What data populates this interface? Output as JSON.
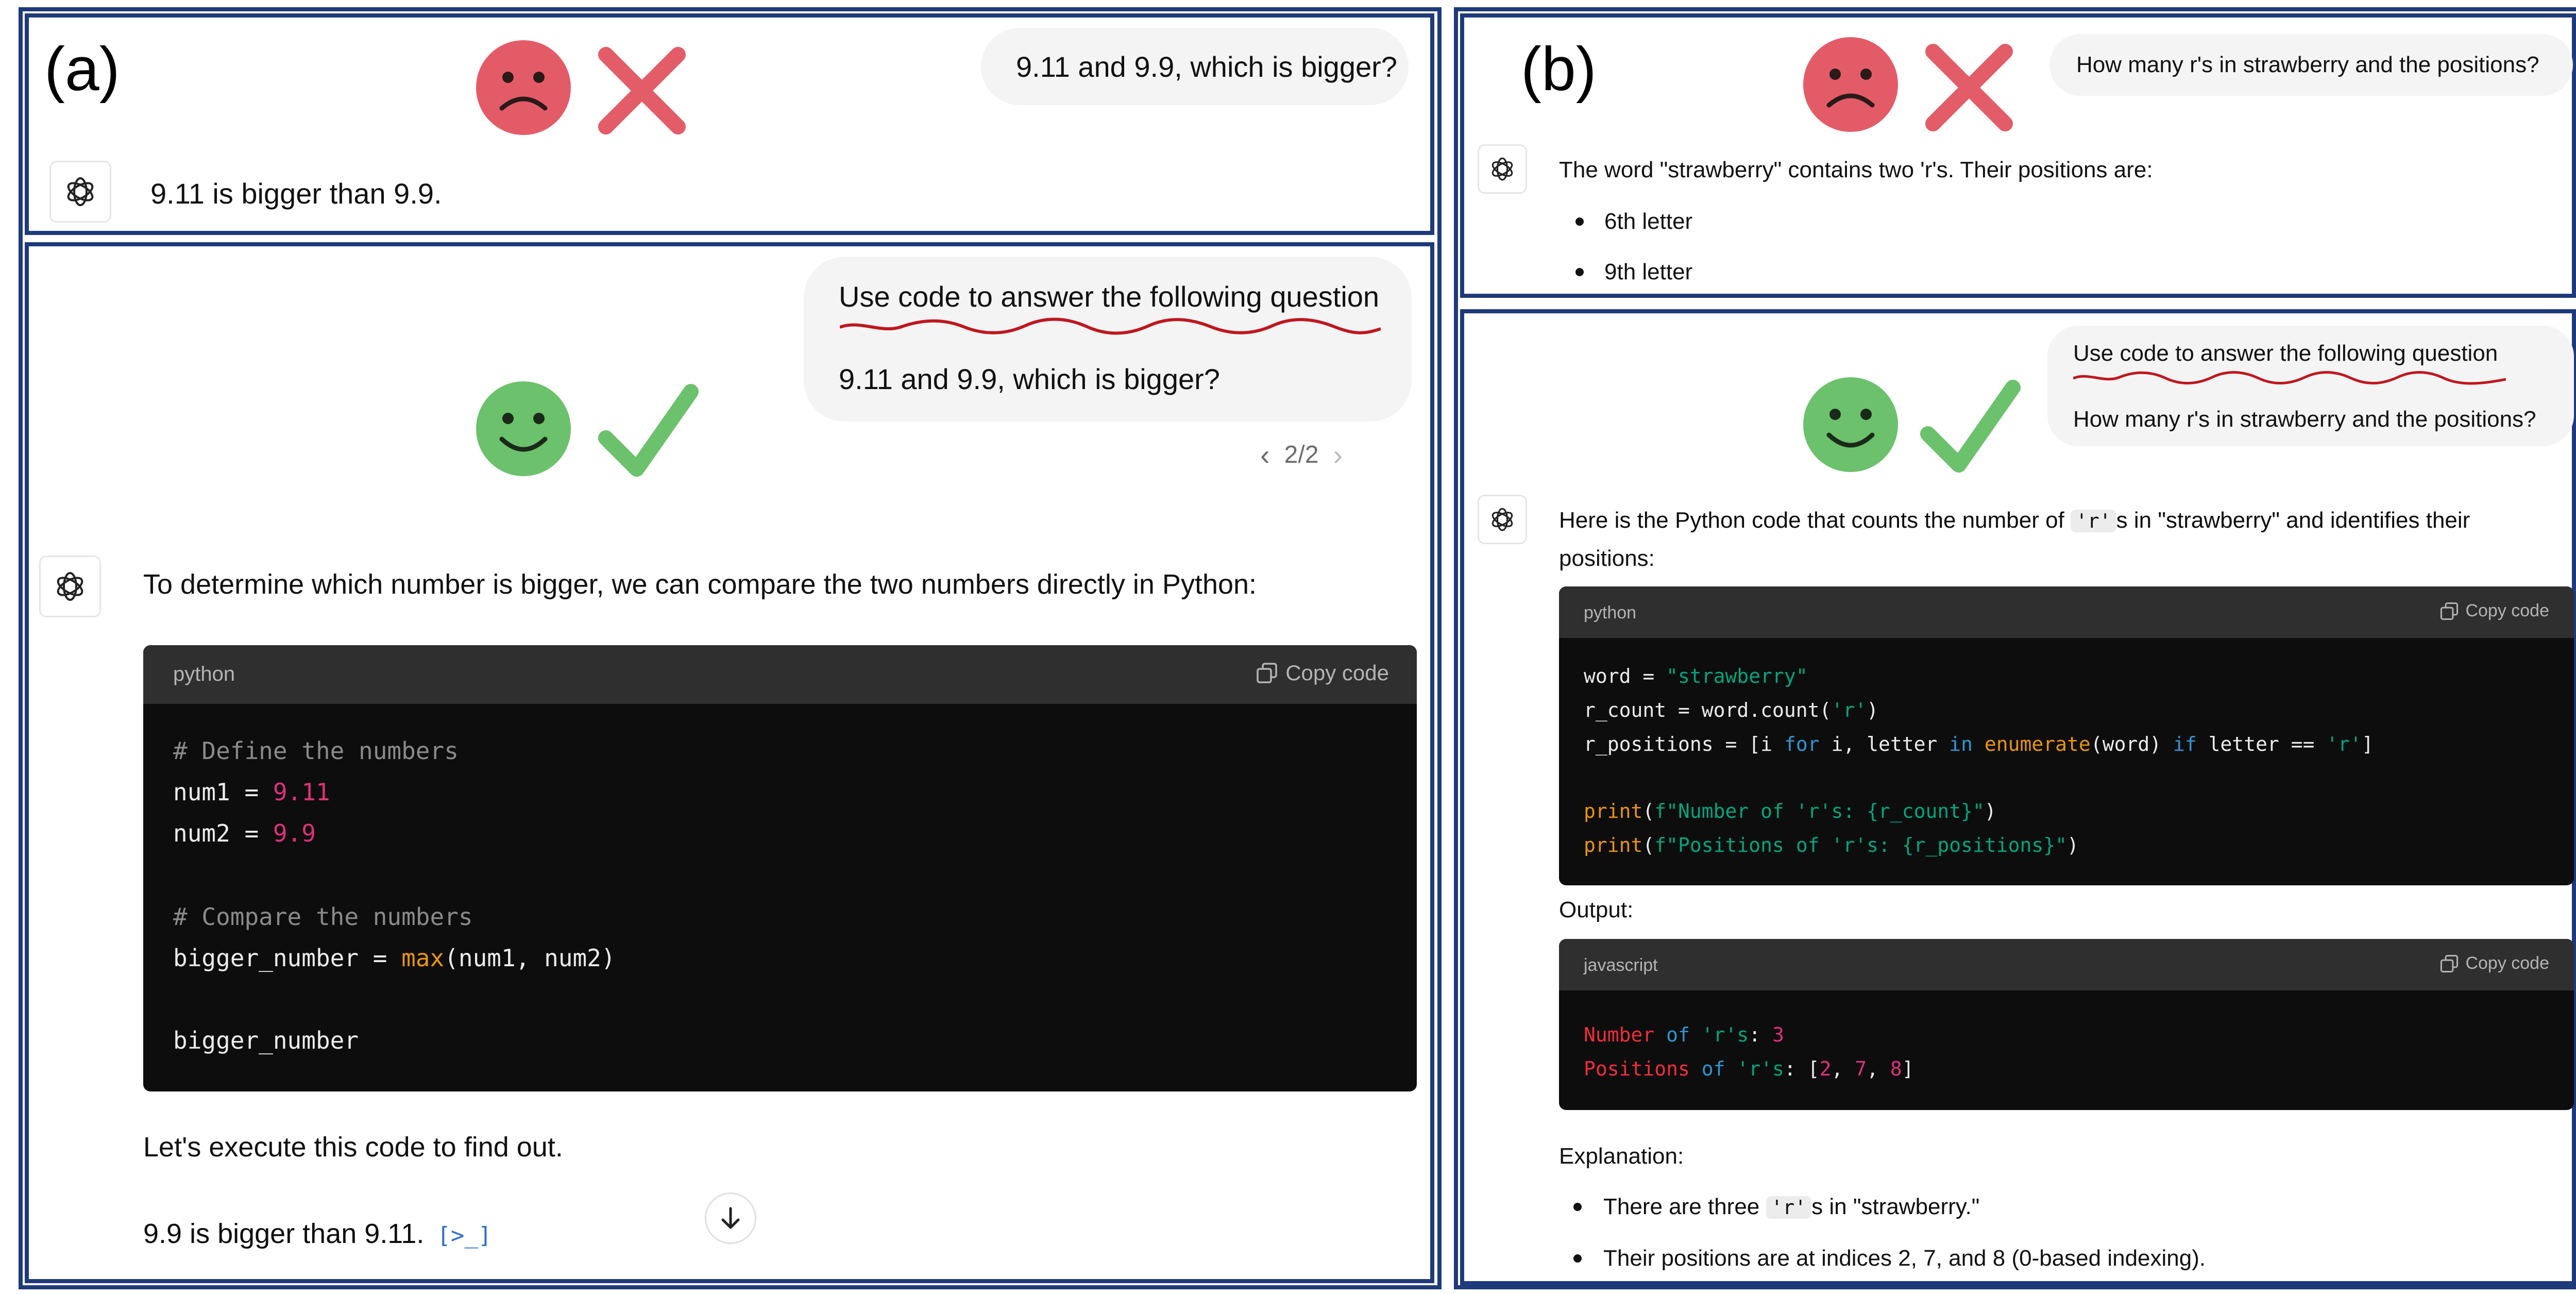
{
  "panel_a": {
    "label": "(a)",
    "wrong": {
      "question": "9.11 and 9.9, which is bigger?",
      "answer": "9.11 is bigger than 9.9."
    },
    "right": {
      "prompt_line1": "Use code to answer the following question",
      "prompt_line2": "9.11 and 9.9, which is bigger?",
      "pager": "2/2",
      "intro": "To determine which number is bigger, we can compare the two numbers directly in Python:",
      "code_lang": "python",
      "copy_label": "Copy code",
      "code": {
        "l1": "# Define the numbers",
        "l2_a": "num1 = ",
        "l2_b": "9.11",
        "l3_a": "num2 = ",
        "l3_b": "9.9",
        "l4": "# Compare the numbers",
        "l5_a": "bigger_number = ",
        "l5_b": "max",
        "l5_c": "(num1, num2)",
        "l6": "bigger_number"
      },
      "execute_text": "Let's execute this code to find out.",
      "result_text": "9.9 is bigger than 9.11.",
      "result_badge": "[>_]"
    }
  },
  "panel_b": {
    "label": "(b)",
    "wrong": {
      "question": "How many r's in strawberry and the positions?",
      "answer": "The word \"strawberry\" contains two 'r's. Their positions are:",
      "bullets": [
        "6th letter",
        "9th letter"
      ]
    },
    "right": {
      "prompt_line1": "Use code to answer the following question",
      "prompt_line2": "How many r's in strawberry and the positions?",
      "intro_a": "Here is the Python code that counts the number of ",
      "intro_code": "'r'",
      "intro_b": "s in \"strawberry\" and identifies their",
      "intro_c": "positions:",
      "code_lang": "python",
      "copy_label": "Copy code",
      "code": {
        "l1_a": "word = ",
        "l1_b": "\"strawberry\"",
        "l2_a": "r_count = word.count(",
        "l2_b": "'r'",
        "l2_c": ")",
        "l3_a": "r_positions = [i ",
        "l3_b": "for",
        "l3_c": " i, letter ",
        "l3_d": "in",
        "l3_e": " ",
        "l3_f": "enumerate",
        "l3_g": "(word) ",
        "l3_h": "if",
        "l3_i": " letter == ",
        "l3_j": "'r'",
        "l3_k": "]",
        "l4_a": "print",
        "l4_b": "(",
        "l4_c": "f\"Number of 'r's: {r_count}\"",
        "l4_d": ")",
        "l5_a": "print",
        "l5_b": "(",
        "l5_c": "f\"Positions of 'r's: {r_positions}\"",
        "l5_d": ")"
      },
      "output_label": "Output:",
      "out_lang": "javascript",
      "out": {
        "l1_a": "Number",
        "l1_b": " of ",
        "l1_c": "'r's",
        "l1_d": ": ",
        "l1_e": "3",
        "l2_a": "Positions",
        "l2_b": " of ",
        "l2_c": "'r's",
        "l2_d": ": [",
        "l2_e": "2",
        "l2_f": ", ",
        "l2_g": "7",
        "l2_h": ", ",
        "l2_i": "8",
        "l2_j": "]"
      },
      "explanation_label": "Explanation:",
      "exp1_a": "There are three ",
      "exp1_code": "'r'",
      "exp1_b": "s in \"strawberry.\"",
      "exp2": "Their positions are at indices 2, 7, and 8 (0-based indexing)."
    }
  },
  "colors": {
    "frame": "#1f3a7a",
    "sad_face": "#e45b68",
    "happy_face": "#6cc16c",
    "cross": "#e35d68",
    "check": "#6cc16c",
    "squiggle": "#c0161f"
  }
}
